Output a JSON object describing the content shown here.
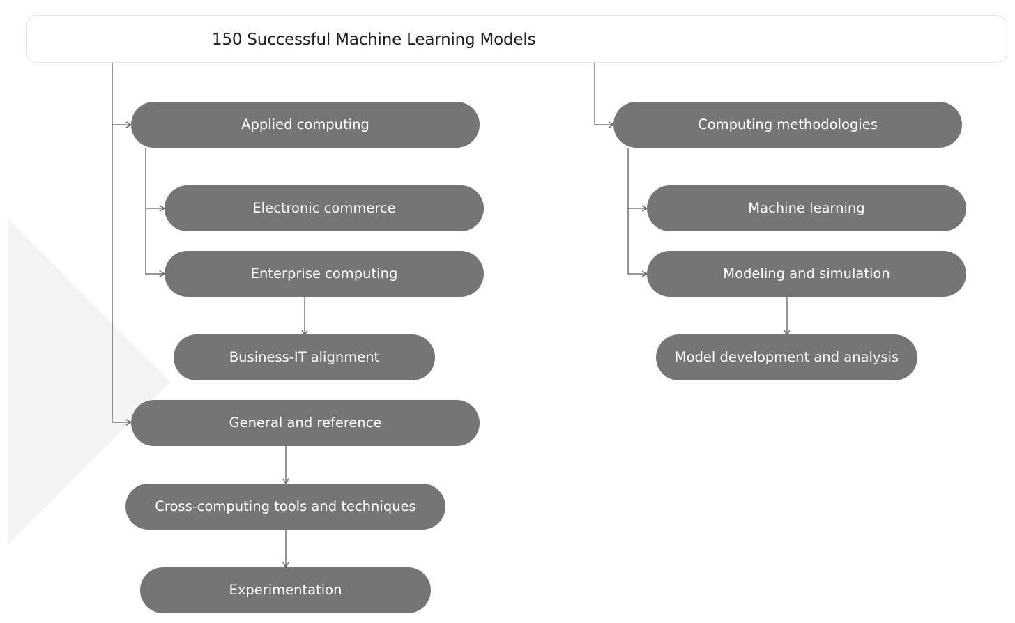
{
  "colors": {
    "node_fill": "#757575",
    "node_text": "#ffffff",
    "connector": "#5c5c5c",
    "root_border": "#e3e3e3",
    "background_shape": "#f4f4f4"
  },
  "diagram": {
    "root": {
      "title": "150 Successful Machine Learning Models"
    },
    "nodes": {
      "applied_computing": "Applied computing",
      "electronic_commerce": "Electronic commerce",
      "enterprise_computing": "Enterprise computing",
      "business_it_alignment": "Business-IT alignment",
      "general_and_reference": "General and reference",
      "cross_computing_tools": "Cross-computing tools and techniques",
      "experimentation": "Experimentation",
      "computing_methodologies": "Computing methodologies",
      "machine_learning": "Machine learning",
      "modeling_and_simulation": "Modeling and simulation",
      "model_development_and_analysis": "Model development and analysis"
    }
  }
}
